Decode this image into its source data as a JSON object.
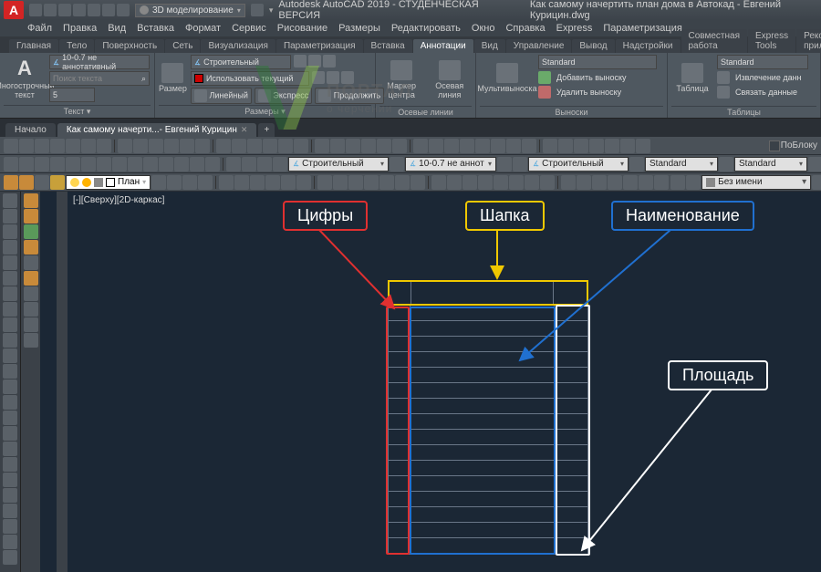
{
  "titlebar": {
    "app_letter": "A",
    "workspace": "3D моделирование",
    "title1": "Autodesk AutoCAD 2019 - СТУДЕНЧЕСКАЯ ВЕРСИЯ",
    "title2": "Как самому начертить план дома в Автокад - Евгений Курицин.dwg"
  },
  "menu": [
    "Файл",
    "Правка",
    "Вид",
    "Вставка",
    "Формат",
    "Сервис",
    "Рисование",
    "Размеры",
    "Редактировать",
    "Окно",
    "Справка",
    "Express",
    "Параметризация"
  ],
  "ribbon_tabs": [
    "Главная",
    "Тело",
    "Поверхность",
    "Сеть",
    "Визуализация",
    "Параметризация",
    "Вставка",
    "Аннотации",
    "Вид",
    "Управление",
    "Вывод",
    "Надстройки",
    "Совместная работа",
    "Express Tools",
    "Рекомендованные приложения"
  ],
  "ribbon_active_idx": 7,
  "panels": {
    "text": {
      "big_label": "Многострочный текст",
      "style": "10-0.7 не аннотативный",
      "search_ph": "Поиск текста",
      "height": "5",
      "title": "Текст ▾"
    },
    "dim": {
      "big_label": "Размер",
      "style": "Строительный",
      "use_current": "Использовать текущий",
      "btns": [
        "Линейный",
        "Экспресс",
        "Продолжить"
      ],
      "title": "Размеры ▾"
    },
    "centerlines": {
      "b1": "Маркер центра",
      "b2": "Осевая линия",
      "title": "Осевые линии"
    },
    "leaders": {
      "big_label": "Мультивыноска",
      "style": "Standard",
      "add": "Добавить выноску",
      "remove": "Удалить выноску",
      "title": "Выноски"
    },
    "tables": {
      "big_label": "Таблица",
      "style": "Standard",
      "extract": "Извлечение данн",
      "link": "Связать данные",
      "title": "Таблицы"
    }
  },
  "doctabs": {
    "t1": "Начало",
    "t2": "Как самому начерти...- Евгений Курицин"
  },
  "toolbars": {
    "style_dd1": "Строительный",
    "style_dd2": "10-0.7 не аннот",
    "style_dd3": "Строительный",
    "std1": "Standard",
    "std2": "Standard",
    "lock_label": "ПоБлоку",
    "layer": "План",
    "unnamed": "Без имени"
  },
  "viewport_label": "[-][Сверху][2D-каркас]",
  "watermark": {
    "l1": "ПОРТАЛ",
    "l2": "о черчении"
  },
  "annotations": {
    "red": "Цифры",
    "yellow": "Шапка",
    "blue": "Наименование",
    "white": "Площадь"
  },
  "table_rows": 16
}
